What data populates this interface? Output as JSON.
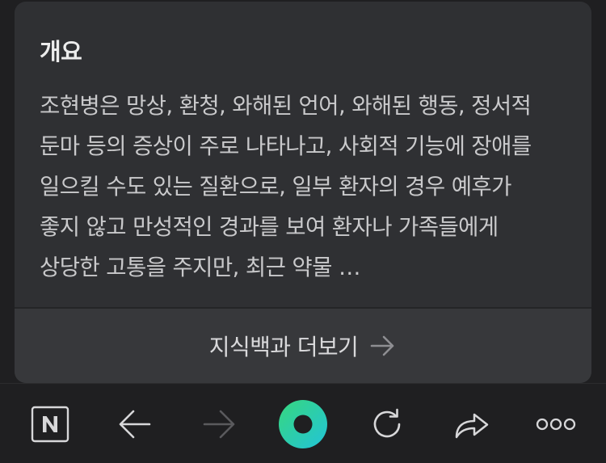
{
  "card": {
    "title": "개요",
    "summary": "조현병은 망상, 환청, 와해된 언어, 와해된 행동, 정서적 둔마 등의 증상이 주로 나타나고, 사회적 기능에 장애를 일으킬 수도 있는 질환으로, 일부 환자의 경우 예후가 좋지 않고 만성적인 경과를 보여 환자나 가족들에게 상당한 고통을 주지만, 최근 약물 …",
    "more_label": "지식백과 더보기"
  },
  "toolbar": {
    "items": [
      {
        "name": "naver-home",
        "icon": "n-logo-icon"
      },
      {
        "name": "back",
        "icon": "arrow-left-icon"
      },
      {
        "name": "forward",
        "icon": "arrow-right-icon",
        "disabled": true
      },
      {
        "name": "green-dot-menu",
        "icon": "green-dot-icon"
      },
      {
        "name": "reload",
        "icon": "refresh-icon"
      },
      {
        "name": "share",
        "icon": "share-icon"
      },
      {
        "name": "more",
        "icon": "more-dots-icon"
      }
    ]
  },
  "colors": {
    "background": "#1f1f21",
    "card": "#2f3033",
    "card_footer": "#37383b",
    "text": "#c9c9cb",
    "title": "#ececec",
    "accent_green_start": "#37d77e",
    "accent_green_end": "#22c4d8",
    "icon": "#d7d7d9",
    "icon_disabled": "#5a5a5d"
  }
}
